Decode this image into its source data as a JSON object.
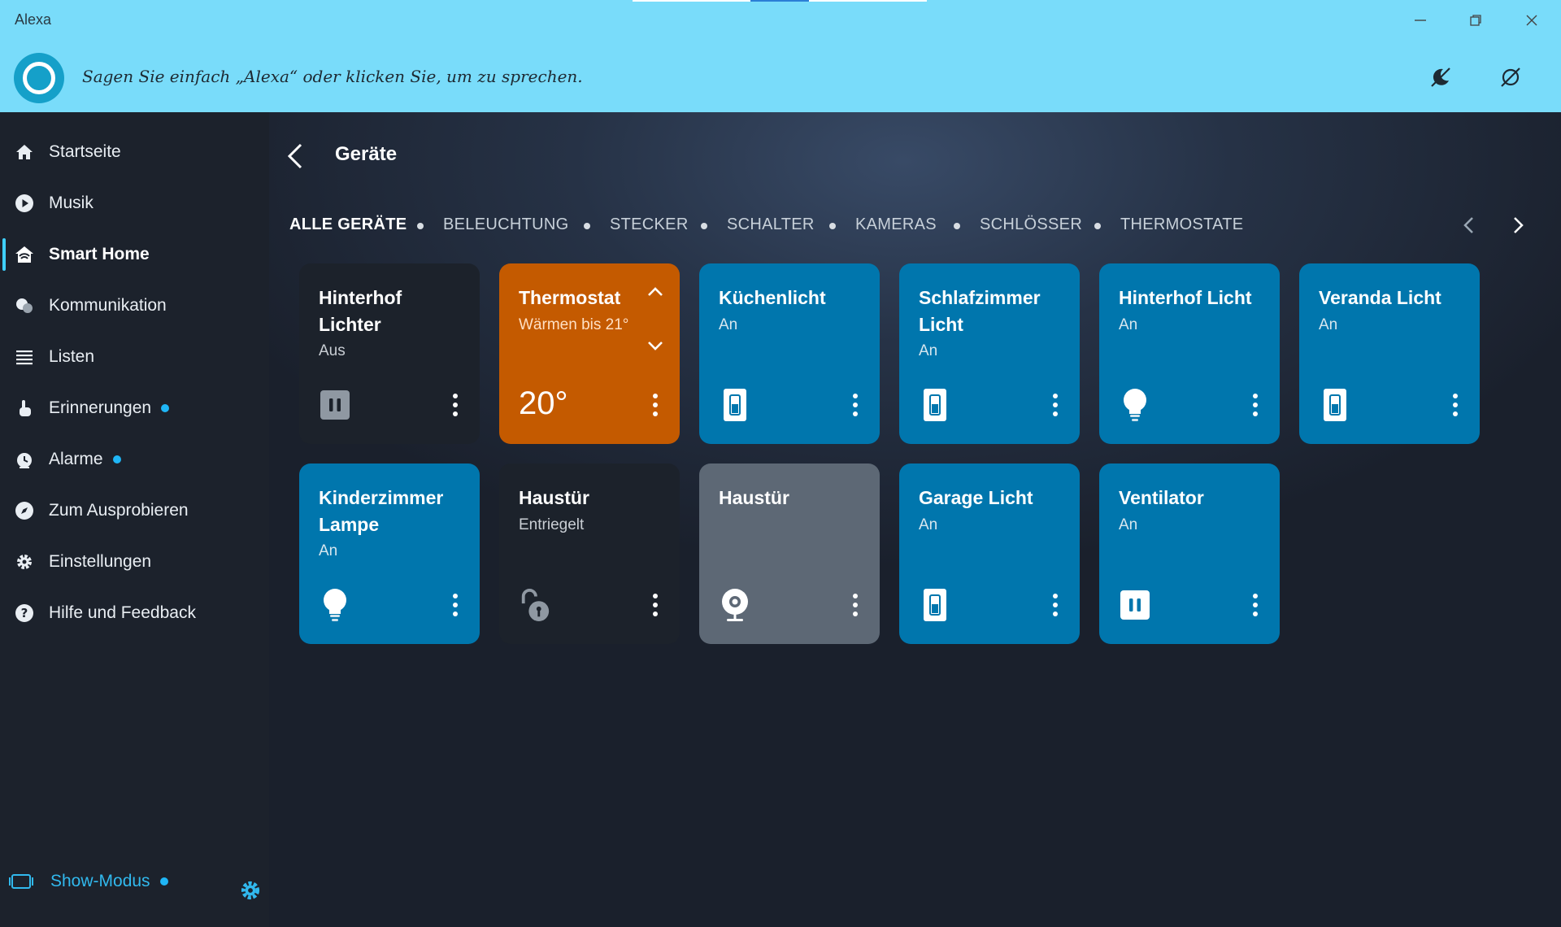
{
  "window": {
    "title": "Alexa"
  },
  "voice_bar": {
    "prompt": "Sagen Sie einfach „Alexa“ oder klicken Sie, um zu sprechen."
  },
  "sidebar": {
    "items": [
      {
        "label": "Startseite",
        "icon": "home-icon"
      },
      {
        "label": "Musik",
        "icon": "play-icon"
      },
      {
        "label": "Smart Home",
        "icon": "smart-home-icon",
        "active": true
      },
      {
        "label": "Kommunikation",
        "icon": "chat-bubbles-icon"
      },
      {
        "label": "Listen",
        "icon": "list-icon"
      },
      {
        "label": "Erinnerungen",
        "icon": "reminder-hand-icon",
        "badge": true
      },
      {
        "label": "Alarme",
        "icon": "alarm-clock-icon",
        "badge": true
      },
      {
        "label": "Zum Ausprobieren",
        "icon": "compass-icon"
      },
      {
        "label": "Einstellungen",
        "icon": "gear-icon"
      },
      {
        "label": "Hilfe und Feedback",
        "icon": "help-icon"
      }
    ],
    "show_mode": {
      "label": "Show-Modus",
      "badge": true
    }
  },
  "main": {
    "title": "Geräte",
    "filters": [
      "ALLE GERÄTE",
      "BELEUCHTUNG",
      "STECKER",
      "SCHALTER",
      "KAMERAS",
      "SCHLÖSSER",
      "THERMOSTATE"
    ],
    "active_filter": "ALLE GERÄTE",
    "devices": [
      {
        "name": "Hinterhof Lichter",
        "status": "Aus",
        "style": "dark",
        "icon": "plug-icon"
      },
      {
        "name": "Thermostat",
        "status": "Wärmen bis 21°",
        "temperature": "20°",
        "style": "orange",
        "icon": "thermostat"
      },
      {
        "name": "Küchenlicht",
        "status": "An",
        "style": "blue",
        "icon": "switch-icon"
      },
      {
        "name": "Schlafzimmer Licht",
        "status": "An",
        "style": "blue",
        "icon": "switch-icon"
      },
      {
        "name": "Hinterhof Licht",
        "status": "An",
        "style": "blue",
        "icon": "bulb-icon"
      },
      {
        "name": "Veranda Licht",
        "status": "An",
        "style": "blue",
        "icon": "switch-icon"
      },
      {
        "name": "Kinderzimmer Lampe",
        "status": "An",
        "style": "blue",
        "icon": "bulb-icon"
      },
      {
        "name": "Haustür",
        "status": "Entriegelt",
        "style": "dark",
        "icon": "unlocked-lock-icon"
      },
      {
        "name": "Haustür",
        "status": "",
        "style": "gray",
        "icon": "camera-icon"
      },
      {
        "name": "Garage Licht",
        "status": "An",
        "style": "blue",
        "icon": "switch-icon"
      },
      {
        "name": "Ventilator",
        "status": "An",
        "style": "blue",
        "icon": "plug-icon"
      }
    ]
  },
  "colors": {
    "topbar": "#79dcfa",
    "card_blue": "#0076ad",
    "card_orange": "#c45a00",
    "card_dark": "#1c222b",
    "card_gray": "#5d6875",
    "accent": "#1fb6f6"
  }
}
